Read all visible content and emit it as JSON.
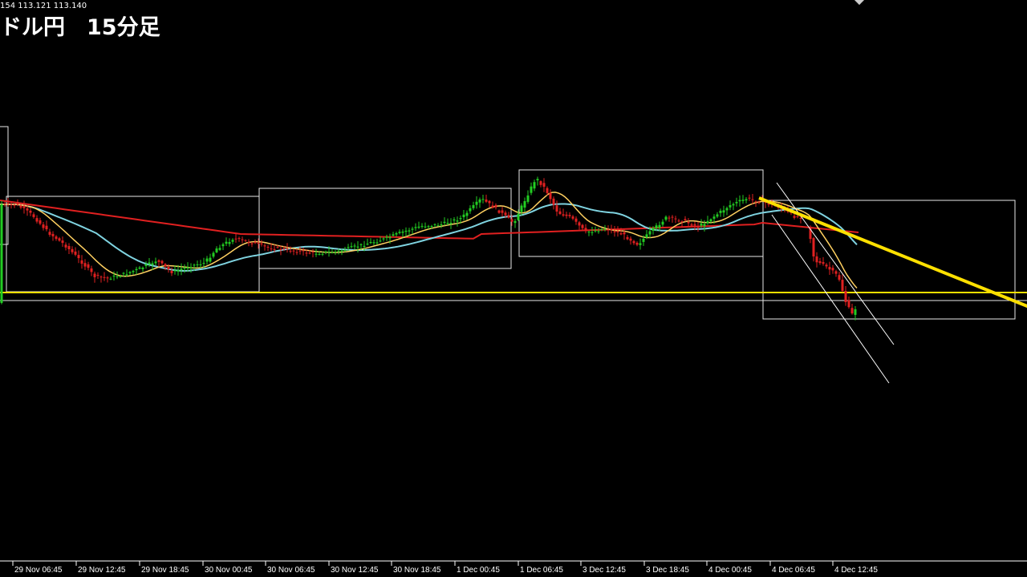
{
  "header": {
    "ohlc_readout": "154 113.121 113.140",
    "title": "ドル円　15分足"
  },
  "chart_data": {
    "type": "candlestick",
    "instrument": "ドル円",
    "timeframe": "15分足",
    "x_tick_labels": [
      "29 Nov 06:45",
      "29 Nov 12:45",
      "29 Nov 18:45",
      "30 Nov 00:45",
      "30 Nov 06:45",
      "30 Nov 12:45",
      "30 Nov 18:45",
      "1 Dec 00:45",
      "1 Dec 06:45",
      "3 Dec 12:45",
      "3 Dec 18:45",
      "4 Dec 00:45",
      "4 Dec 06:45",
      "4 Dec 12:45"
    ],
    "series": [
      {
        "kind": "moving-average",
        "color": "#ffd060"
      },
      {
        "kind": "moving-average",
        "color": "#7fd3e0"
      },
      {
        "kind": "moving-average",
        "color": "#e02020"
      }
    ],
    "colors": {
      "up_candle": "#22cc22",
      "down_candle": "#e02020",
      "ma_fast": "#ffd060",
      "ma_mid": "#7fd3e0",
      "ma_slow": "#e02020",
      "support_line": "#ffe000",
      "trendline": "#ffe000",
      "boxes": "#e8e8e8",
      "channel": "#ffffff",
      "axis": "#ffffff"
    },
    "grid": false
  }
}
